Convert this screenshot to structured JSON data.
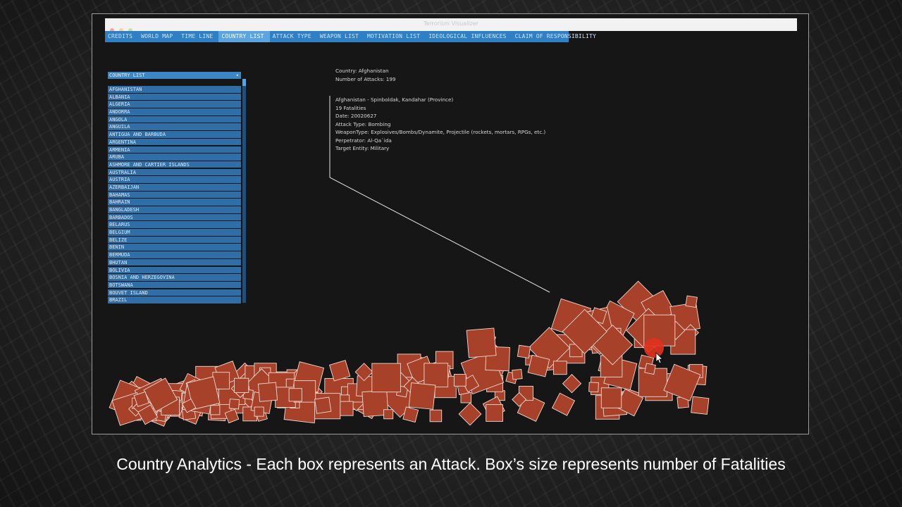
{
  "window": {
    "title": "Terrorism Visualizer"
  },
  "nav": {
    "tabs": [
      {
        "label": "CREDITS",
        "active": false
      },
      {
        "label": "WORLD MAP",
        "active": false
      },
      {
        "label": "TIME LINE",
        "active": false
      },
      {
        "label": "COUNTRY LIST",
        "active": true
      },
      {
        "label": "ATTACK TYPE",
        "active": false
      },
      {
        "label": "WEAPON LIST",
        "active": false
      },
      {
        "label": "MOTIVATION LIST",
        "active": false
      },
      {
        "label": "IDEOLOGICAL INFLUENCES",
        "active": false
      },
      {
        "label": "CLAIM OF RESPONSIBILITY",
        "active": false
      }
    ]
  },
  "country_list": {
    "header": "COUNTRY LIST",
    "items": [
      "AFGHANISTAN",
      "ALBANIA",
      "ALGERIA",
      "ANDORRA",
      "ANGOLA",
      "ANGUILA",
      "ANTIGUA AND BARBUDA",
      "ARGENTINA",
      "ARMENIA",
      "ARUBA",
      "ASHMORE AND CARTIER ISLANDS",
      "AUSTRALIA",
      "AUSTRIA",
      "AZERBAIJAN",
      "BAHAMAS",
      "BAHRAIN",
      "BANGLADESH",
      "BARBADOS",
      "BELARUS",
      "BELGIUM",
      "BELIZE",
      "BENIN",
      "BERMUDA",
      "BHUTAN",
      "BOLIVIA",
      "BOSNIA AND HERZEGOVINA",
      "BOTSWANA",
      "BOUVET ISLAND",
      "BRAZIL"
    ]
  },
  "summary": {
    "country": "Country: Afghanistan",
    "attacks": "Number of Attacks: 199"
  },
  "details": {
    "location": "Afghanistan - Spinboldak, Kandahar (Province)",
    "fatalities": "19 Fatalities",
    "date": "Date: 20020627",
    "attack_type": "Attack Type: Bombing",
    "weapon_type": "WeaponType: Explosives/Bombs/Dynamite, Projectile (rockets, mortars, RPGs, etc.)",
    "perpetrator": "Perpetrator: Al-Qa`ida",
    "target": "Target Entity: Military"
  },
  "caption": "Country Analytics - Each box represents an Attack. Box’s size represents number of Fatalities",
  "colors": {
    "box_fill": "#a8412a",
    "box_stroke": "#eed9d0",
    "nav_bar": "#2e7fc4",
    "list_item": "#2f6ea6",
    "cursor_highlight": "#e0321e"
  },
  "chart_data": {
    "type": "box-pile",
    "encoding": "Each box represents an Attack. Box’s size represents number of Fatalities",
    "attack_count": 199,
    "selected_attack_fatalities": 19
  }
}
